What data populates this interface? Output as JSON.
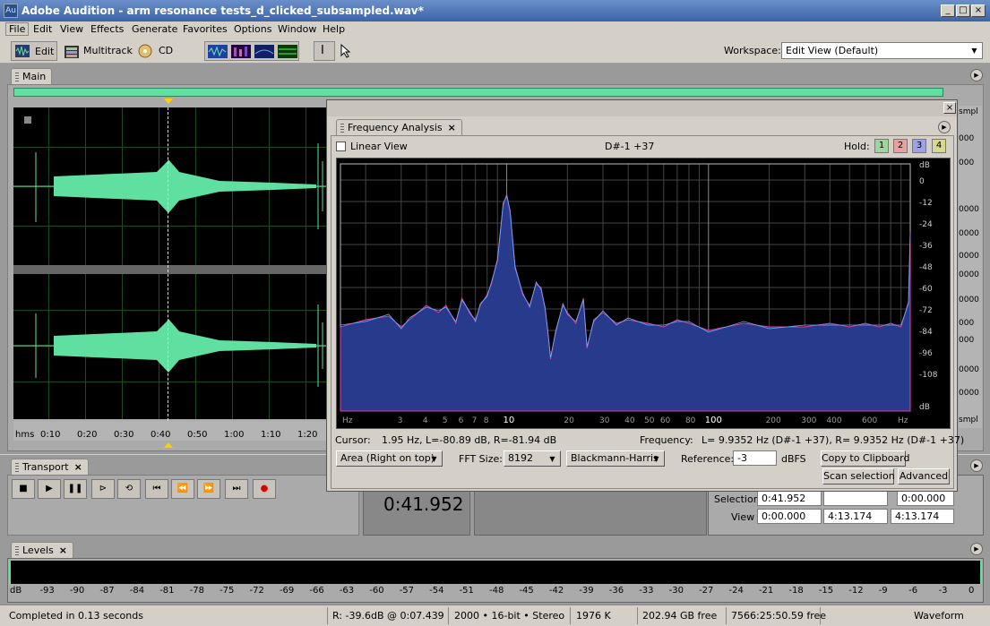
{
  "window": {
    "title": "Adobe Audition - arm resonance tests_d_clicked_subsampled.wav*",
    "app_icon": "Au"
  },
  "menubar": [
    "File",
    "Edit",
    "View",
    "Effects",
    "Generate",
    "Favorites",
    "Options",
    "Window",
    "Help"
  ],
  "toolbar": {
    "edit_label": "Edit",
    "multitrack_label": "Multitrack",
    "cd_label": "CD",
    "workspace_label": "Workspace:",
    "workspace_value": "Edit View (Default)"
  },
  "main_panel": {
    "tab": "Main",
    "time_unit": "hms",
    "time_ticks": [
      "0:10",
      "0:20",
      "0:30",
      "0:40",
      "0:50",
      "1:00",
      "1:10",
      "1:20"
    ],
    "right_labels": [
      "smpl",
      "000",
      "000",
      "0000",
      "0000",
      "0000",
      "0000",
      "0000",
      "000",
      "000",
      "0000",
      "0000",
      "smpl"
    ]
  },
  "transport": {
    "tab": "Transport",
    "time_display": "0:41.952"
  },
  "selection": {
    "selection_label": "Selection",
    "view_label": "View",
    "sel_begin": "0:41.952",
    "sel_end": "",
    "sel_length": "0:00.000",
    "view_begin": "0:00.000",
    "view_end": "4:13.174",
    "view_length": "4:13.174"
  },
  "levels": {
    "tab": "Levels",
    "scale": [
      "dB",
      "-93",
      "-90",
      "-87",
      "-84",
      "-81",
      "-78",
      "-75",
      "-72",
      "-69",
      "-66",
      "-63",
      "-60",
      "-57",
      "-54",
      "-51",
      "-48",
      "-45",
      "-42",
      "-39",
      "-36",
      "-33",
      "-30",
      "-27",
      "-24",
      "-21",
      "-18",
      "-15",
      "-12",
      "-9",
      "-6",
      "-3",
      "0"
    ]
  },
  "freq": {
    "tab": "Frequency Analysis",
    "linear_view": "Linear View",
    "note": "D#-1 +37",
    "hold_label": "Hold:",
    "hold": [
      {
        "n": "1",
        "c": "#9fd49f"
      },
      {
        "n": "2",
        "c": "#e8a0a0"
      },
      {
        "n": "3",
        "c": "#a0a0e8"
      },
      {
        "n": "4",
        "c": "#d8d890"
      }
    ],
    "cursor_label": "Cursor:",
    "cursor_value": "1.95 Hz, L=-80.89 dB, R=-81.94 dB",
    "frequency_label": "Frequency:",
    "frequency_value": "L= 9.9352 Hz (D#-1 +37), R= 9.9352 Hz (D#-1 +37)",
    "plot_mode": "Area (Right on top)",
    "fft_label": "FFT Size:",
    "fft_size": "8192",
    "window_fn": "Blackmann-Harris",
    "reference_label": "Reference:",
    "reference_value": "-3",
    "dbfs": "dBFS",
    "copy_btn": "Copy to Clipboard",
    "scan_btn": "Scan selection",
    "advanced_btn": "Advanced",
    "db_ticks": [
      "dB",
      "0",
      "-12",
      "-24",
      "-36",
      "-48",
      "-60",
      "-72",
      "-84",
      "-96",
      "-108",
      "dB"
    ],
    "hz_ticks": [
      "Hz",
      "3",
      "4",
      "5",
      "6",
      "7",
      "8",
      "10",
      "20",
      "30",
      "40",
      "50",
      "60",
      "80",
      "100",
      "200",
      "300",
      "400",
      "600",
      "Hz"
    ]
  },
  "status": {
    "msg": "Completed in 0.13 seconds",
    "pos": "R: -39.6dB @  0:07.439",
    "fmt": "2000 • 16-bit • Stereo",
    "size": "1976 K",
    "free": "202.94 GB free",
    "time_free": "7566:25:50.59 free",
    "view": "Waveform"
  }
}
